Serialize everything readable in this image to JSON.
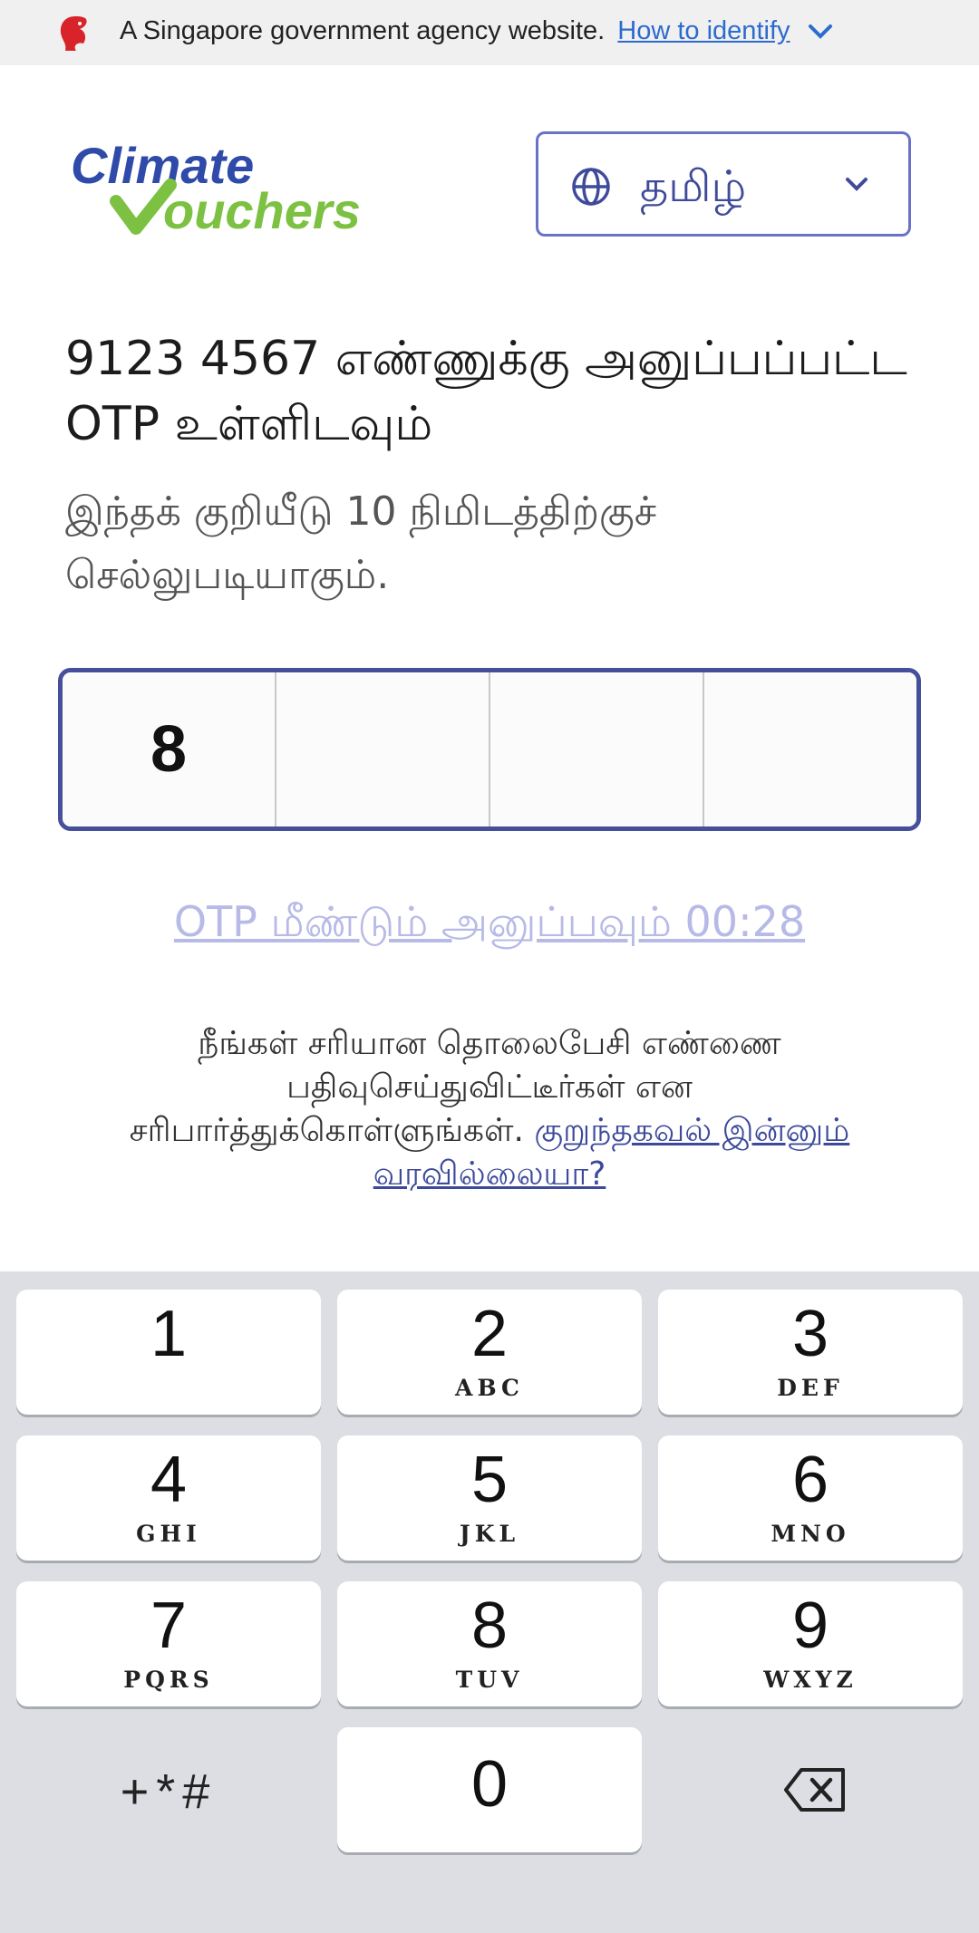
{
  "gov_banner": {
    "text": "A Singapore government agency website.",
    "link": "How to identify"
  },
  "header": {
    "logo_word1": "Climate",
    "logo_word2": "ouchers",
    "language": "தமிழ்"
  },
  "otp": {
    "title": "9123 4567 எண்ணுக்கு அனுப்பப்பட்ட OTP உள்ளிடவும்",
    "subtitle": "இந்தக் குறியீடு 10 நிமிடத்திற்குச் செல்லுபடியாகும்.",
    "digits": [
      "8",
      "",
      "",
      ""
    ],
    "resend": "OTP மீண்டும் அனுப்பவும் 00:28",
    "help_text": "நீங்கள் சரியான தொலைபேசி எண்ணை பதிவுசெய்துவிட்டீர்கள் என சரிபார்த்துக்கொள்ளுங்கள்.",
    "help_link": "குறுந்தகவல் இன்னும் வரவில்லையா?"
  },
  "keypad": {
    "keys": [
      {
        "num": "1",
        "letters": ""
      },
      {
        "num": "2",
        "letters": "ABC"
      },
      {
        "num": "3",
        "letters": "DEF"
      },
      {
        "num": "4",
        "letters": "GHI"
      },
      {
        "num": "5",
        "letters": "JKL"
      },
      {
        "num": "6",
        "letters": "MNO"
      },
      {
        "num": "7",
        "letters": "PQRS"
      },
      {
        "num": "8",
        "letters": "TUV"
      },
      {
        "num": "9",
        "letters": "WXYZ"
      },
      {
        "num": "0",
        "letters": ""
      }
    ],
    "symbols": "+*#"
  },
  "colors": {
    "accent": "#46509a",
    "logo_blue": "#2f4aa8",
    "logo_green": "#7cc142",
    "link": "#3d4a9b",
    "resend_disabled": "#b7bae6"
  }
}
